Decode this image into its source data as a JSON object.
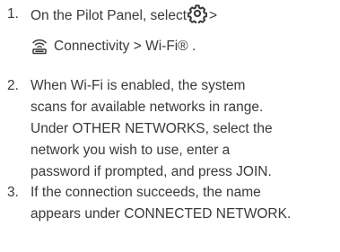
{
  "steps": [
    {
      "number": "1.",
      "line1_text": "On the Pilot Panel, select",
      "line1_after_icon": ">",
      "icon_1": "gear-icon",
      "icon_2": "wifi-connectivity-icon",
      "line2_text": "Connectivity > Wi-Fi® ."
    },
    {
      "number": "2.",
      "lines": [
        "When Wi-Fi is enabled, the system",
        "scans for available networks in range.",
        "Under OTHER NETWORKS, select the",
        "network you wish to use, enter a",
        "password if prompted, and press JOIN."
      ]
    },
    {
      "number": "3.",
      "lines": [
        "If the connection succeeds, the name",
        "appears under CONNECTED NETWORK."
      ]
    }
  ],
  "colors": {
    "text": "#3a3a3a",
    "background": "#ffffff"
  }
}
